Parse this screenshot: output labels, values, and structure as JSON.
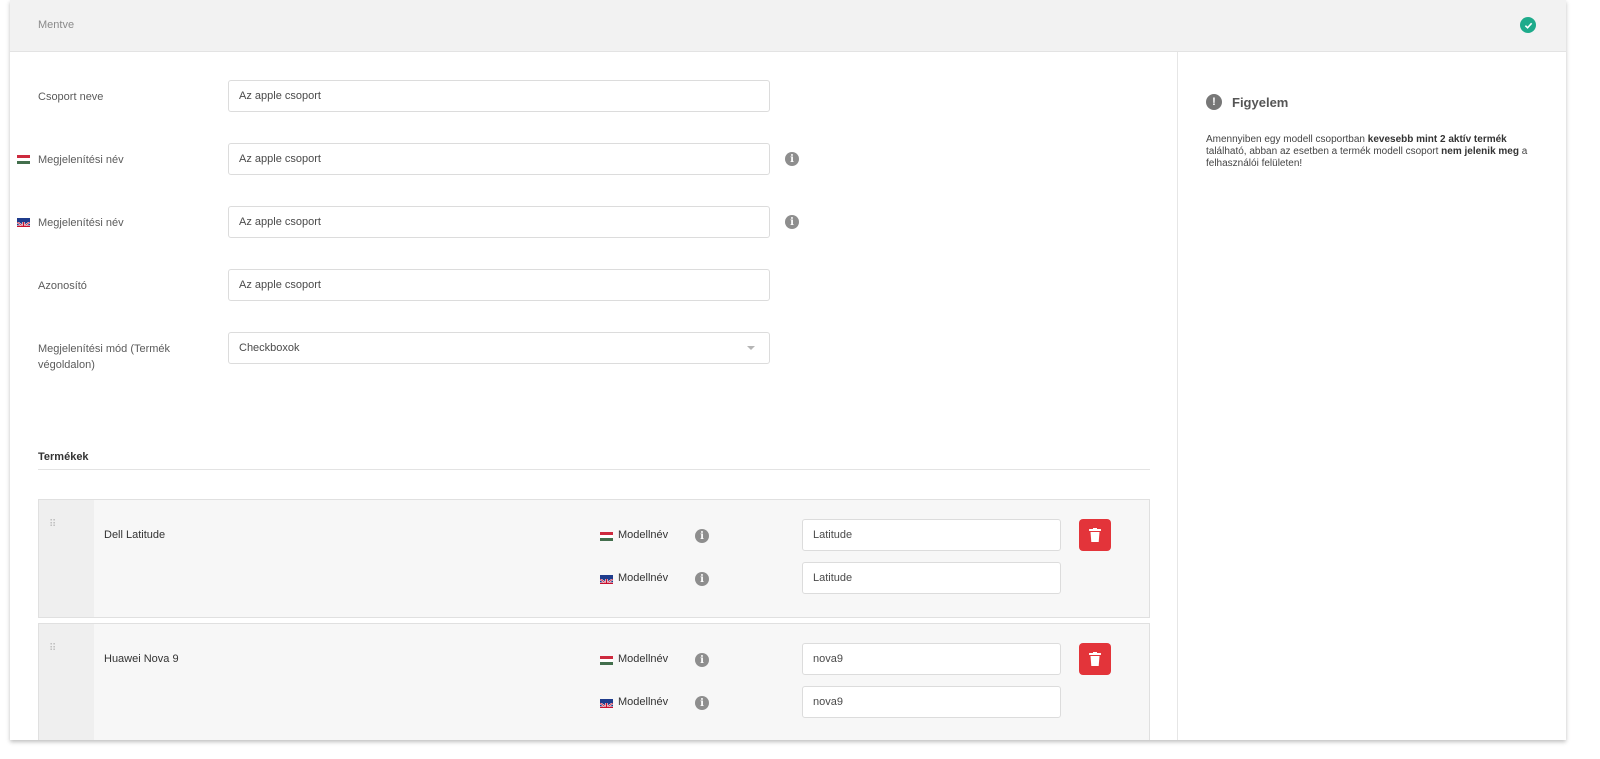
{
  "status": {
    "text": "Mentve"
  },
  "form": {
    "group_name": {
      "label": "Csoport neve",
      "value": "Az apple csoport"
    },
    "display_name_hu": {
      "label": "Megjelenítési név",
      "value": "Az apple csoport"
    },
    "display_name_en": {
      "label": "Megjelenítési név",
      "value": "Az apple csoport"
    },
    "identifier": {
      "label": "Azonosító",
      "value": "Az apple csoport"
    },
    "display_mode": {
      "label_line1": "Megjelenítési mód (Termék",
      "label_line2": "végoldalon)",
      "value": "Checkboxok"
    }
  },
  "products_section": {
    "title": "Termékek",
    "model_label": "Modellnév",
    "items": [
      {
        "name": "Dell Latitude",
        "model_hu": "Latitude",
        "model_en": "Latitude"
      },
      {
        "name": "Huawei Nova 9",
        "model_hu": "nova9",
        "model_en": "nova9"
      }
    ]
  },
  "notice": {
    "title": "Figyelem",
    "text_1": "Amennyiben egy modell csoportban ",
    "bold_1": "kevesebb mint 2 aktív termék",
    "text_2": " található, abban az esetben a termék modell csoport ",
    "bold_2": "nem jelenik meg",
    "text_3": " a felhasználói felületen!"
  },
  "colors": {
    "success": "#1eab8b",
    "danger": "#e3343a"
  }
}
